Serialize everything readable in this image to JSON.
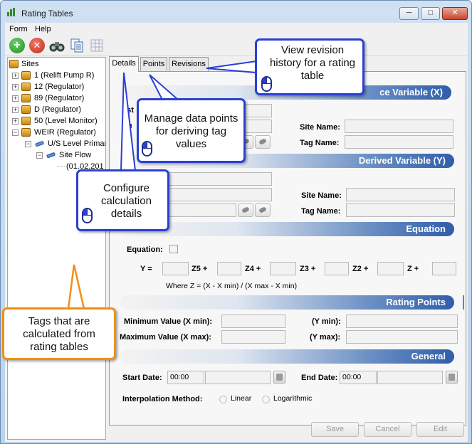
{
  "window": {
    "title": "Rating Tables",
    "minimize": "─",
    "maximize": "□",
    "close": "✕"
  },
  "menu": [
    "Form",
    "Help"
  ],
  "toolbar": {
    "add_glyph": "+",
    "delete_glyph": "✕"
  },
  "tree": {
    "root": "Sites",
    "items": [
      "1 (Relift Pump R)",
      "12 (Regulator)",
      "89 (Regulator)",
      "D (Regulator)",
      "50 (Level Monitor)",
      "WEIR (Regulator)"
    ],
    "child": "U/S Level Primar",
    "grandchild": "Site Flow",
    "leaf": "(01.02.201"
  },
  "tabs": [
    "Details",
    "Points",
    "Revisions"
  ],
  "sections": {
    "source": "ce Variable (X)",
    "derived": "Derived Variable (Y)",
    "equation": "Equation",
    "rating_points": "Rating Points",
    "general": "General"
  },
  "source_fields": {
    "partial_label_1": "yst",
    "partial_label_2": "ou",
    "site_name": "Site Name:",
    "tag_name": "Tag Name:"
  },
  "derived_fields": {
    "site_name": "Site Name:",
    "tag_name": "Tag Name:"
  },
  "equation": {
    "label": "Equation:",
    "y": "Y =",
    "terms": [
      "Z5 +",
      "Z4 +",
      "Z3 +",
      "Z2 +",
      "Z +"
    ],
    "formula": "Where Z = (X - X min) / (X max - X min)"
  },
  "rating_points": {
    "x_min": "Minimum Value (X min):",
    "x_max": "Maximum Value (X max):",
    "y_min": "(Y min):",
    "y_max": "(Y max):"
  },
  "general": {
    "start_date": "Start Date:",
    "end_date": "End Date:",
    "start_time": "00:00",
    "end_time": "00:00",
    "interpolation": "Interpolation Method:",
    "linear": "Linear",
    "logarithmic": "Logarithmic"
  },
  "buttons": {
    "save": "Save",
    "cancel": "Cancel",
    "edit": "Edit"
  },
  "callouts": {
    "revisions": "View revision history for a rating table",
    "points": "Manage data points for deriving tag values",
    "details": "Configure calculation details",
    "tags": "Tags that are calculated from rating tables"
  },
  "colors": {
    "callout_blue": "#2a3fd6",
    "callout_orange": "#f28e14",
    "section_blue": "#2f5ea8"
  }
}
